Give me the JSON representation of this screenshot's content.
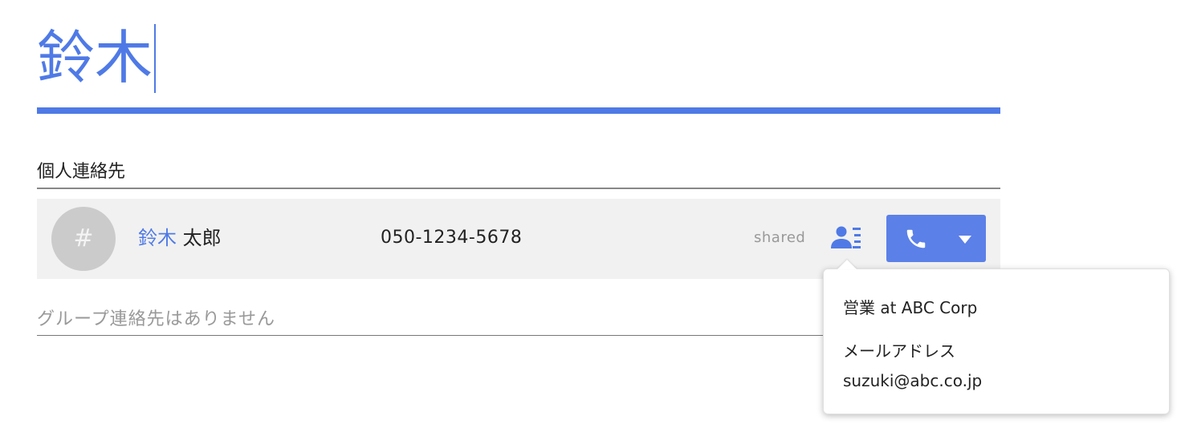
{
  "search": {
    "query": "鈴木"
  },
  "personal_section": {
    "title": "個人連絡先",
    "contact": {
      "avatar_text": "#",
      "name_match": "鈴木",
      "name_rest": "太郎",
      "phone": "050-1234-5678",
      "shared_label": "shared",
      "icons": {
        "card": "contact-card-icon",
        "call": "phone-icon",
        "dropdown": "chevron-down-icon"
      }
    }
  },
  "group_section": {
    "empty_text": "グループ連絡先はありません"
  },
  "popover": {
    "title": "営業 at ABC Corp",
    "email_label": "メールアドレス",
    "email_value": "suzuki@abc.co.jp"
  },
  "colors": {
    "accent": "#4f7ae6",
    "button": "#5b80e8",
    "row_bg": "#f1f1f1",
    "avatar_bg": "#cbcbcb"
  }
}
